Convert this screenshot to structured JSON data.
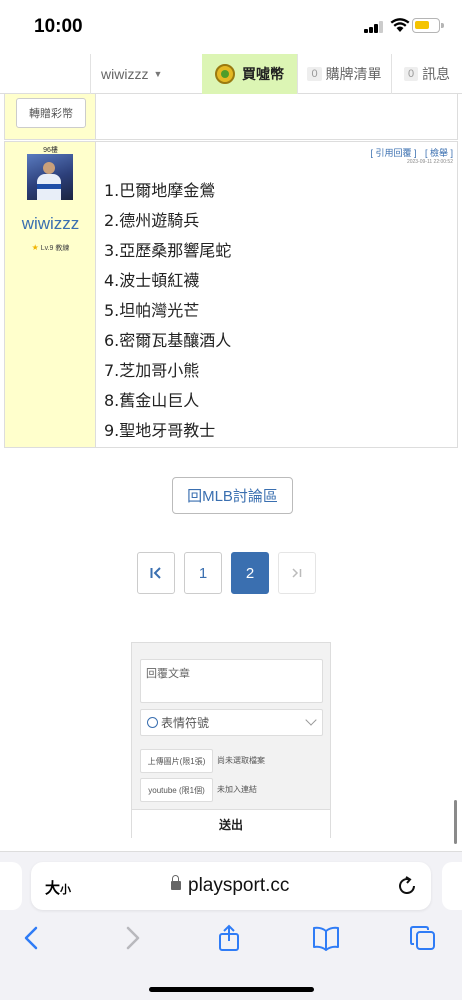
{
  "status_bar": {
    "time": "10:00"
  },
  "site_nav": {
    "username": "wiwizzz",
    "buy_coins": "買噓幣",
    "cart": {
      "count": "0",
      "label": "購牌清單"
    },
    "messages": {
      "count": "0",
      "label": "訊息"
    }
  },
  "prev_post": {
    "gift_button": "轉贈彩幣"
  },
  "post": {
    "floor": "96樓",
    "author": "wiwizzz",
    "level": "Lv.9 教練",
    "actions": {
      "quote_reply": "[ 引用回覆 ]",
      "report": "[ 檢舉 ]"
    },
    "timestamp": "2023-09-11 22:00:52",
    "lines": [
      "1.巴爾地摩金鶯",
      "2.德州遊騎兵",
      "3.亞歷桑那響尾蛇",
      "4.波士頓紅襪",
      "5.坦帕灣光芒",
      "6.密爾瓦基釀酒人",
      "7.芝加哥小熊",
      "8.舊金山巨人",
      "9.聖地牙哥教士"
    ]
  },
  "back_button": "回MLB討論區",
  "pagination": {
    "pages": [
      "1",
      "2"
    ],
    "current": "2"
  },
  "reply_form": {
    "textarea_placeholder": "回覆文章",
    "emoji_label": "表情符號",
    "image_upload": "上傳圖片(限1張)",
    "image_status": "尚未選取檔案",
    "youtube_upload": "youtube (限1個)",
    "youtube_status": "未加入連結",
    "submit": "送出"
  },
  "safari": {
    "text_size": "大",
    "text_size_small": "小",
    "url": "playsport.cc"
  },
  "colors": {
    "link_blue": "#3a6fb0",
    "post_sidebar": "#ffffcc",
    "buy_highlight": "#dcf5b4",
    "battery": "#f5c400"
  }
}
